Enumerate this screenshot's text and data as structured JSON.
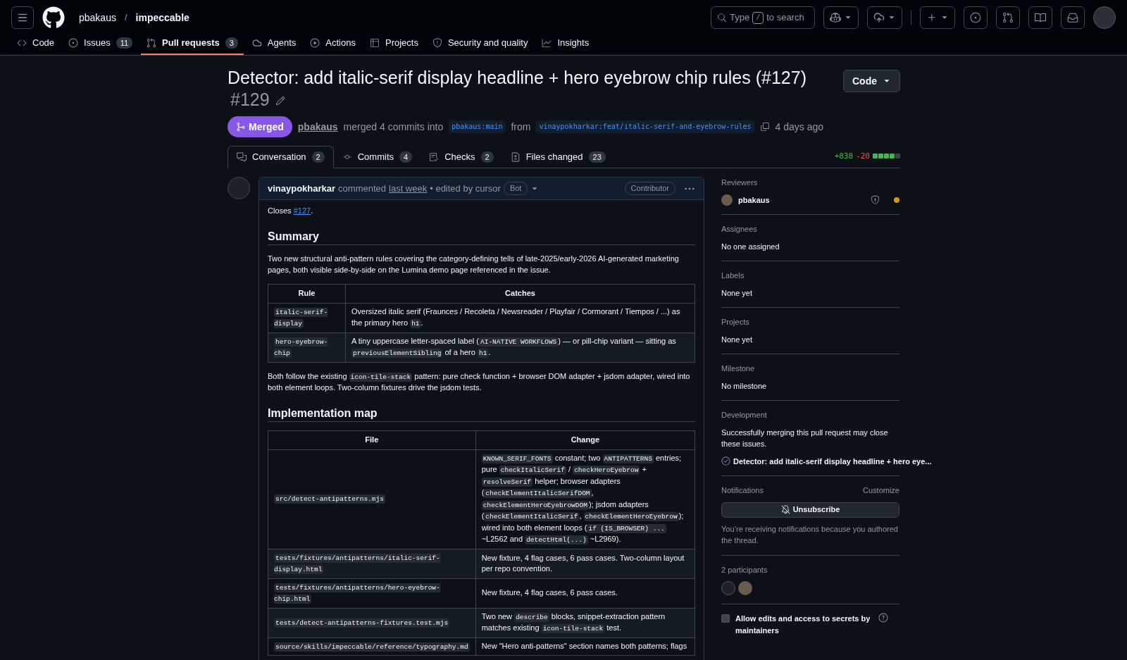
{
  "header": {
    "owner": "pbakaus",
    "separator": "/",
    "repo": "impeccable",
    "search": {
      "prefix": "Type",
      "key": "/",
      "suffix": "to search"
    }
  },
  "repo_tabs": [
    {
      "label": "Code",
      "selected": false
    },
    {
      "label": "Issues",
      "count": "11",
      "selected": false
    },
    {
      "label": "Pull requests",
      "count": "3",
      "selected": true
    },
    {
      "label": "Agents",
      "selected": false
    },
    {
      "label": "Actions",
      "selected": false
    },
    {
      "label": "Projects",
      "selected": false
    },
    {
      "label": "Security and quality",
      "selected": false
    },
    {
      "label": "Insights",
      "selected": false
    }
  ],
  "pr": {
    "title": "Detector: add italic-serif display headline + hero eyebrow chip rules (#127)",
    "number": "#129",
    "code_button": "Code",
    "status": "Merged",
    "author": "pbakaus",
    "merge_text": "merged 4 commits into",
    "base": "pbakaus:main",
    "from": "from",
    "head": "vinaypokharkar:feat/italic-serif-and-eyebrow-rules",
    "time": "4 days ago"
  },
  "pr_tabs": [
    {
      "label": "Conversation",
      "count": "2",
      "selected": true
    },
    {
      "label": "Commits",
      "count": "4",
      "selected": false
    },
    {
      "label": "Checks",
      "count": "2",
      "selected": false
    },
    {
      "label": "Files changed",
      "count": "23",
      "selected": false
    }
  ],
  "diffstat": {
    "additions": "+838",
    "deletions": "-20"
  },
  "comment": {
    "author": "vinaypokharkar",
    "action": "commented",
    "time": "last week",
    "edited": "• edited by cursor",
    "bot": "Bot",
    "role": "Contributor",
    "body": [
      {
        "kind": "paragraph",
        "segments": [
          {
            "kind": "text",
            "text": "Closes "
          },
          {
            "kind": "link",
            "text": "#127"
          },
          {
            "kind": "text",
            "text": "."
          }
        ]
      },
      {
        "kind": "heading",
        "text": "Summary"
      },
      {
        "kind": "paragraph",
        "segments": [
          {
            "kind": "text",
            "text": "Two new structural anti-pattern rules covering the category-defining tells of late-2025/early-2026 AI-generated marketing pages, both visible side-by-side on the Lumina demo page referenced in the issue."
          }
        ]
      },
      {
        "kind": "table",
        "columns": [
          "Rule",
          "Catches"
        ],
        "rows": [
          [
            [
              {
                "kind": "code",
                "text": "italic-serif-display"
              }
            ],
            [
              {
                "kind": "text",
                "text": "Oversized italic serif (Fraunces / Recoleta / Newsreader / Playfair / Cormorant / Tiempos / ...) as the primary hero "
              },
              {
                "kind": "code",
                "text": "h1"
              },
              {
                "kind": "text",
                "text": "."
              }
            ]
          ],
          [
            [
              {
                "kind": "code",
                "text": "hero-eyebrow-chip"
              }
            ],
            [
              {
                "kind": "text",
                "text": "A tiny uppercase letter-spaced label ("
              },
              {
                "kind": "code",
                "text": "AI-NATIVE WORKFLOWS"
              },
              {
                "kind": "text",
                "text": ") — or pill-chip variant — sitting as "
              },
              {
                "kind": "code",
                "text": "previousElementSibling"
              },
              {
                "kind": "text",
                "text": " of a hero "
              },
              {
                "kind": "code",
                "text": "h1"
              },
              {
                "kind": "text",
                "text": "."
              }
            ]
          ]
        ]
      },
      {
        "kind": "paragraph",
        "segments": [
          {
            "kind": "text",
            "text": "Both follow the existing "
          },
          {
            "kind": "code",
            "text": "icon-tile-stack"
          },
          {
            "kind": "text",
            "text": " pattern: pure check function + browser DOM adapter + jsdom adapter, wired into both element loops. Two-column fixtures drive the jsdom tests."
          }
        ]
      },
      {
        "kind": "heading",
        "text": "Implementation map"
      },
      {
        "kind": "table",
        "columns": [
          "File",
          "Change"
        ],
        "rows": [
          [
            [
              {
                "kind": "code",
                "text": "src/detect-antipatterns.mjs"
              }
            ],
            [
              {
                "kind": "code",
                "text": "KNOWN_SERIF_FONTS"
              },
              {
                "kind": "text",
                "text": " constant; two "
              },
              {
                "kind": "code",
                "text": "ANTIPATTERNS"
              },
              {
                "kind": "text",
                "text": " entries; pure "
              },
              {
                "kind": "code",
                "text": "checkItalicSerif"
              },
              {
                "kind": "text",
                "text": " / "
              },
              {
                "kind": "code",
                "text": "checkHeroEyebrow"
              },
              {
                "kind": "text",
                "text": " + "
              },
              {
                "kind": "code",
                "text": "resolveSerif"
              },
              {
                "kind": "text",
                "text": " helper; browser adapters ("
              },
              {
                "kind": "code",
                "text": "checkElementItalicSerifDOM"
              },
              {
                "kind": "text",
                "text": ", "
              },
              {
                "kind": "code",
                "text": "checkElementHeroEyebrowDOM"
              },
              {
                "kind": "text",
                "text": "); jsdom adapters ("
              },
              {
                "kind": "code",
                "text": "checkElementItalicSerif"
              },
              {
                "kind": "text",
                "text": ", "
              },
              {
                "kind": "code",
                "text": "checkElementHeroEyebrow"
              },
              {
                "kind": "text",
                "text": "); wired into both element loops ("
              },
              {
                "kind": "code",
                "text": "if (IS_BROWSER) ..."
              },
              {
                "kind": "text",
                "text": " ~L2562 and "
              },
              {
                "kind": "code",
                "text": "detectHtml(...)"
              },
              {
                "kind": "text",
                "text": " ~L2969)."
              }
            ]
          ],
          [
            [
              {
                "kind": "code",
                "text": "tests/fixtures/antipatterns/italic-serif-display.html"
              }
            ],
            [
              {
                "kind": "text",
                "text": "New fixture, 4 flag cases, 6 pass cases. Two-column layout per repo convention."
              }
            ]
          ],
          [
            [
              {
                "kind": "code",
                "text": "tests/fixtures/antipatterns/hero-eyebrow-chip.html"
              }
            ],
            [
              {
                "kind": "text",
                "text": "New fixture, 4 flag cases, 6 pass cases."
              }
            ]
          ],
          [
            [
              {
                "kind": "code",
                "text": "tests/detect-antipatterns-fixtures.test.mjs"
              }
            ],
            [
              {
                "kind": "text",
                "text": "Two new "
              },
              {
                "kind": "code",
                "text": "describe"
              },
              {
                "kind": "text",
                "text": " blocks, snippet-extraction pattern matches existing "
              },
              {
                "kind": "code",
                "text": "icon-tile-stack"
              },
              {
                "kind": "text",
                "text": " test."
              }
            ]
          ],
          [
            [
              {
                "kind": "code",
                "text": "source/skills/impeccable/reference/typography.md"
              }
            ],
            [
              {
                "kind": "text",
                "text": "New \"Hero anti-patterns\" section names both patterns; flags"
              }
            ]
          ]
        ]
      }
    ]
  },
  "sidebar": {
    "reviewers": {
      "title": "Reviewers",
      "name": "pbakaus"
    },
    "sections": [
      {
        "title": "Assignees",
        "value": "No one assigned"
      },
      {
        "title": "Labels",
        "value": "None yet"
      },
      {
        "title": "Projects",
        "value": "None yet"
      },
      {
        "title": "Milestone",
        "value": "No milestone"
      }
    ],
    "development": {
      "title": "Development",
      "text": "Successfully merging this pull request may close these issues.",
      "issue": "Detector: add italic-serif display headline + hero eye..."
    },
    "notifications": {
      "title": "Notifications",
      "customize": "Customize",
      "button": "Unsubscribe",
      "note": "You’re receiving notifications because you authored the thread."
    },
    "participants": {
      "title": "2 participants"
    },
    "maintainer_edits": {
      "label": "Allow edits and access to secrets by maintainers",
      "checked": false
    }
  }
}
